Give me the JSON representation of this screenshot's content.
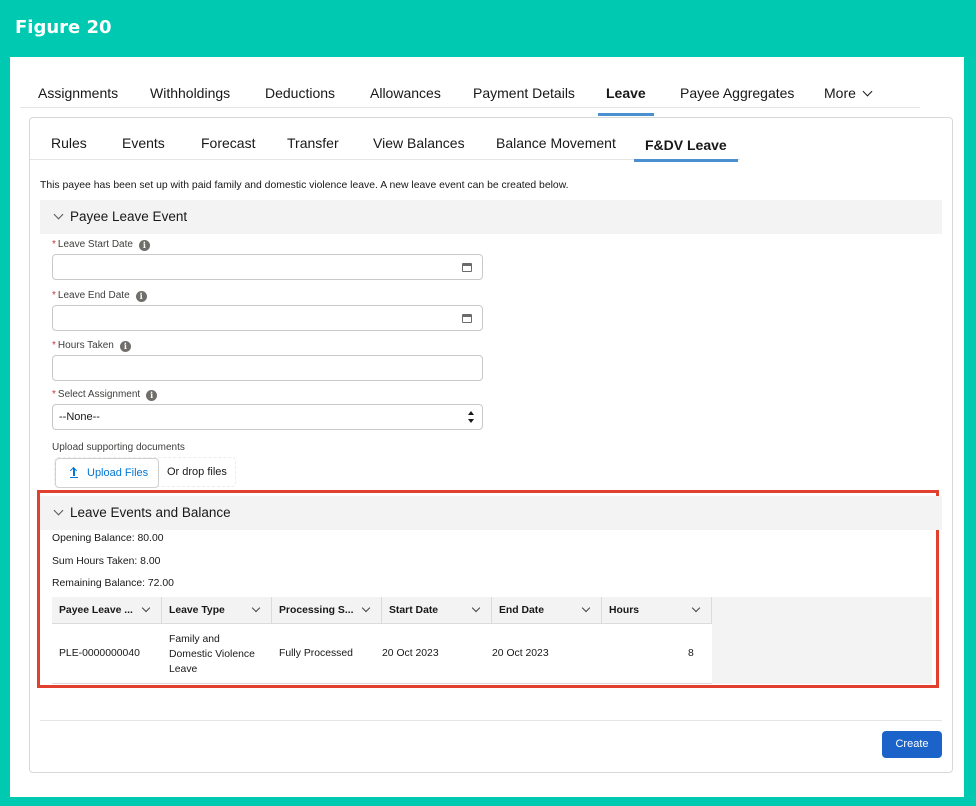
{
  "figure": {
    "title": "Figure 20"
  },
  "top_tabs": [
    {
      "label": "Assignments"
    },
    {
      "label": "Withholdings"
    },
    {
      "label": "Deductions"
    },
    {
      "label": "Allowances"
    },
    {
      "label": "Payment Details"
    },
    {
      "label": "Leave",
      "active": true
    },
    {
      "label": "Payee Aggregates"
    },
    {
      "label": "More"
    }
  ],
  "sub_tabs": [
    {
      "label": "Rules"
    },
    {
      "label": "Events"
    },
    {
      "label": "Forecast"
    },
    {
      "label": "Transfer"
    },
    {
      "label": "View Balances"
    },
    {
      "label": "Balance Movement"
    },
    {
      "label": "F&DV Leave",
      "active": true
    }
  ],
  "intro_text": "This payee has been set up with paid family and domestic violence leave. A new leave event can be created below.",
  "leave_event_section": {
    "title": "Payee Leave Event",
    "fields": {
      "start_date": {
        "label": "Leave Start Date",
        "value": ""
      },
      "end_date": {
        "label": "Leave End Date",
        "value": ""
      },
      "hours_taken": {
        "label": "Hours Taken",
        "value": ""
      },
      "assignment": {
        "label": "Select Assignment",
        "value": "--None--"
      }
    },
    "upload": {
      "label": "Upload supporting documents",
      "button_label": "Upload Files",
      "drop_text": "Or drop files"
    }
  },
  "balance_section": {
    "title": "Leave Events and Balance",
    "opening_balance": "Opening Balance: 80.00",
    "sum_hours": "Sum Hours Taken: 8.00",
    "remaining_balance": "Remaining Balance: 72.00",
    "columns": [
      "Payee Leave ...",
      "Leave Type",
      "Processing S...",
      "Start Date",
      "End Date",
      "Hours"
    ],
    "rows": [
      {
        "id": "PLE-0000000040",
        "type_lines": [
          "Family and",
          "Domestic Violence",
          "Leave"
        ],
        "processing": "Fully Processed",
        "start": "20 Oct 2023",
        "end": "20 Oct 2023",
        "hours": "8"
      }
    ]
  },
  "actions": {
    "create_label": "Create"
  },
  "colors": {
    "frame_bg": "#00c9b1",
    "accent": "#4a8fd0",
    "primary_button": "#1b63c8",
    "highlight": "#e2402e",
    "required": "#c23934"
  }
}
